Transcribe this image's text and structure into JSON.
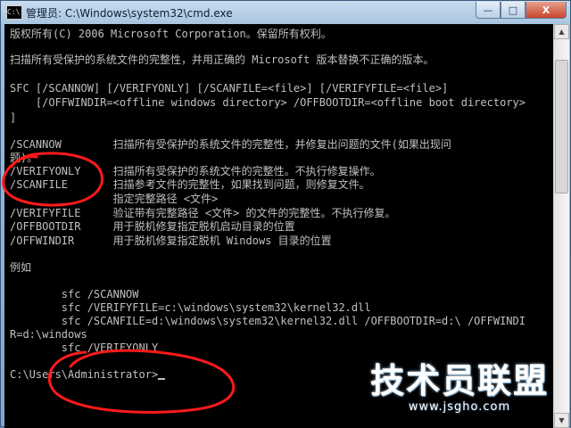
{
  "window": {
    "title": "管理员: C:\\Windows\\system32\\cmd.exe",
    "app_icon_glyph": "C:\\",
    "controls": {
      "minimize": "—",
      "maximize": "□",
      "close": "X"
    }
  },
  "console": {
    "lines": [
      "版权所有(C) 2006 Microsoft Corporation。保留所有权利。",
      "扫描所有受保护的系统文件的完整性，并用正确的 Microsoft 版本替换不正确的版本。",
      "SFC [/SCANNOW] [/VERIFYONLY] [/SCANFILE=<file>] [/VERIFYFILE=<file>]",
      "    [/OFFWINDIR=<offline windows directory> /OFFBOOTDIR=<offline boot directory>",
      "]",
      "/SCANNOW        扫描所有受保护的系统文件的完整性，并修复出问题的文件(如果出现问",
      "题)。",
      "/VERIFYONLY     扫描所有受保护的系统文件的完整性。不执行修复操作。",
      "/SCANFILE       扫描参考文件的完整性，如果找到问题，则修复文件。",
      "                指定完整路径 <文件>",
      "/VERIFYFILE     验证带有完整路径 <文件> 的文件的完整性。不执行修复。",
      "/OFFBOOTDIR     用于脱机修复指定脱机启动目录的位置",
      "/OFFWINDIR      用于脱机修复指定脱机 Windows 目录的位置",
      "例如",
      "        sfc /SCANNOW",
      "        sfc /VERIFYFILE=c:\\windows\\system32\\kernel32.dll",
      "        sfc /SCANFILE=d:\\windows\\system32\\kernel32.dll /OFFBOOTDIR=d:\\ /OFFWINDI",
      "R=d:\\windows",
      "        sfc /VERIFYONLY",
      "C:\\Users\\Administrator>"
    ]
  },
  "annotation": {
    "color": "#ff1a1a"
  },
  "watermark": {
    "text": "技术员联盟",
    "url": "www.jsgho.com"
  },
  "scrollbar": {
    "up": "▲",
    "down": "▼"
  }
}
